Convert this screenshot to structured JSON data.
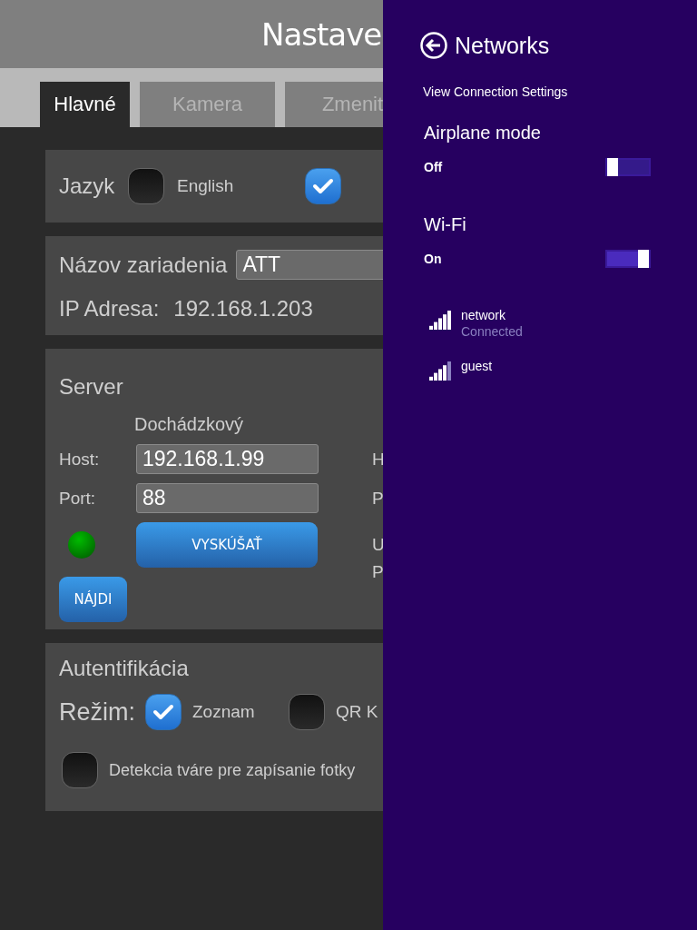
{
  "app": {
    "title": "Nastave",
    "tabs": [
      {
        "label": "Hlavné",
        "selected": true
      },
      {
        "label": "Kamera",
        "selected": false
      },
      {
        "label": "Zmenit",
        "selected": false
      }
    ],
    "language": {
      "label": "Jazyk",
      "options": [
        {
          "label": "English",
          "checked": false
        },
        {
          "checked": true
        }
      ]
    },
    "device": {
      "name_label": "Názov zariadenia",
      "name_value": "ATT",
      "ip_label": "IP Adresa:",
      "ip_value": "192.168.1.203"
    },
    "server": {
      "title": "Server",
      "column_title": "Dochádzkový",
      "host_label": "Host:",
      "host_value": "192.168.1.99",
      "port_label": "Port:",
      "port_value": "88",
      "status_on": true,
      "test_button": "VYSKÚŠAŤ",
      "find_button": "NÁJDI",
      "column_2_labels": [
        "H",
        "P",
        "U",
        "P"
      ]
    },
    "auth": {
      "title": "Autentifikácia",
      "mode_label": "Režim:",
      "modes": [
        {
          "label": "Zoznam",
          "checked": true
        },
        {
          "label": "QR K",
          "checked": false
        }
      ],
      "face_detection": {
        "label": "Detekcia tváre pre zapísanie fotky",
        "checked": false
      }
    }
  },
  "networks_panel": {
    "title": "Networks",
    "link": "View Connection Settings",
    "sections": [
      {
        "title": "Airplane mode",
        "state": "Off",
        "on": false
      },
      {
        "title": "Wi-Fi",
        "state": "On",
        "on": true
      }
    ],
    "networks": [
      {
        "name": "network",
        "status": "Connected",
        "kind": "full"
      },
      {
        "name": "guest",
        "kind": "partial"
      }
    ]
  }
}
